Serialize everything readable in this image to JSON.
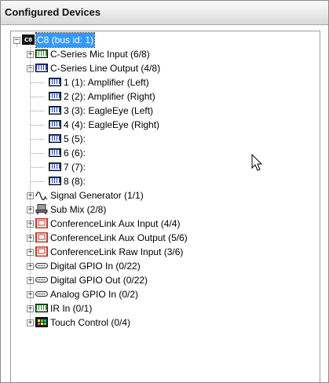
{
  "panel": {
    "title": "Configured Devices"
  },
  "tree": {
    "root": {
      "label": "C8 (bus id: 1)",
      "icon": "c8-device-icon",
      "expander": "−"
    },
    "items": [
      {
        "label": "C-Series Mic Input (6/8)",
        "icon": "green-channel-icon",
        "expander": "+"
      },
      {
        "label": "C-Series Line Output (4/8)",
        "icon": "blue-channel-icon",
        "expander": "−",
        "children": [
          {
            "label": "1 (1): Amplifier (Left)",
            "icon": "blue-channel-icon"
          },
          {
            "label": "2 (2): Amplifier (Right)",
            "icon": "blue-channel-icon"
          },
          {
            "label": "3 (3): EagleEye (Left)",
            "icon": "blue-channel-icon"
          },
          {
            "label": "4 (4): EagleEye (Right)",
            "icon": "blue-channel-icon"
          },
          {
            "label": "5 (5):",
            "icon": "blue-channel-icon"
          },
          {
            "label": "6 (6):",
            "icon": "blue-channel-icon"
          },
          {
            "label": "7 (7):",
            "icon": "blue-channel-icon"
          },
          {
            "label": "8 (8):",
            "icon": "blue-channel-icon"
          }
        ]
      },
      {
        "label": "Signal Generator (1/1)",
        "icon": "waveform-icon",
        "expander": "+"
      },
      {
        "label": "Sub Mix (2/8)",
        "icon": "submix-icon",
        "expander": "+"
      },
      {
        "label": "ConferenceLink Aux Input (4/4)",
        "icon": "conferencelink-icon",
        "expander": "+"
      },
      {
        "label": "ConferenceLink Aux Output (5/6)",
        "icon": "conferencelink-icon",
        "expander": "+"
      },
      {
        "label": "ConferenceLink Raw Input (3/6)",
        "icon": "conferencelink-icon",
        "expander": "+"
      },
      {
        "label": "Digital GPIO In (0/22)",
        "icon": "gpio-connector-icon",
        "expander": "+"
      },
      {
        "label": "Digital GPIO Out (0/22)",
        "icon": "gpio-connector-icon",
        "expander": "+"
      },
      {
        "label": "Analog GPIO In (0/2)",
        "icon": "gpio-connector-icon",
        "expander": "+"
      },
      {
        "label": "IR In (0/1)",
        "icon": "green-channel-icon",
        "expander": "+"
      },
      {
        "label": "Touch Control (0/4)",
        "icon": "touch-control-icon",
        "expander": "+"
      }
    ]
  },
  "colors": {
    "selection": "#3399ff",
    "green_icon": "#2e8b2e",
    "blue_icon": "#1f3fb0",
    "conferencelink": "#c0392b"
  }
}
